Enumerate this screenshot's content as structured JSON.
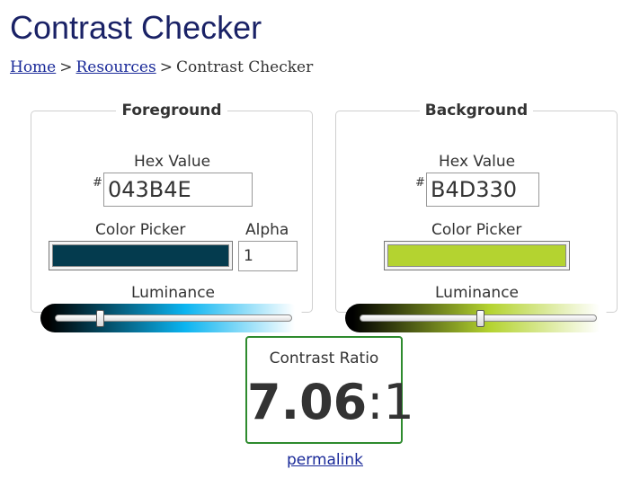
{
  "page": {
    "title": "Contrast Checker"
  },
  "breadcrumb": {
    "items": [
      "Home",
      "Resources"
    ],
    "separator": ">",
    "current": "Contrast Checker"
  },
  "foreground": {
    "legend": "Foreground",
    "hex_label": "Hex Value",
    "hash": "#",
    "hex_value": "043B4E",
    "picker_label": "Color Picker",
    "alpha_label": "Alpha",
    "alpha_value": "1",
    "luminance_label": "Luminance",
    "luminance_level": 0.19,
    "color": "#043b4e",
    "luminance_mid_color": "#0bb4f0"
  },
  "background": {
    "legend": "Background",
    "hex_label": "Hex Value",
    "hash": "#",
    "hex_value": "B4D330",
    "picker_label": "Color Picker",
    "luminance_label": "Luminance",
    "luminance_level": 0.51,
    "color": "#b4d330",
    "luminance_mid_color": "#b4d330"
  },
  "result": {
    "label": "Contrast Ratio",
    "ratio_number": "7.06",
    "ratio_suffix": ":1",
    "pass_color": "#2e8b2e"
  },
  "permalink": {
    "label": "permalink"
  },
  "colors": {
    "title": "#1a2266",
    "link": "#1a2a99"
  }
}
